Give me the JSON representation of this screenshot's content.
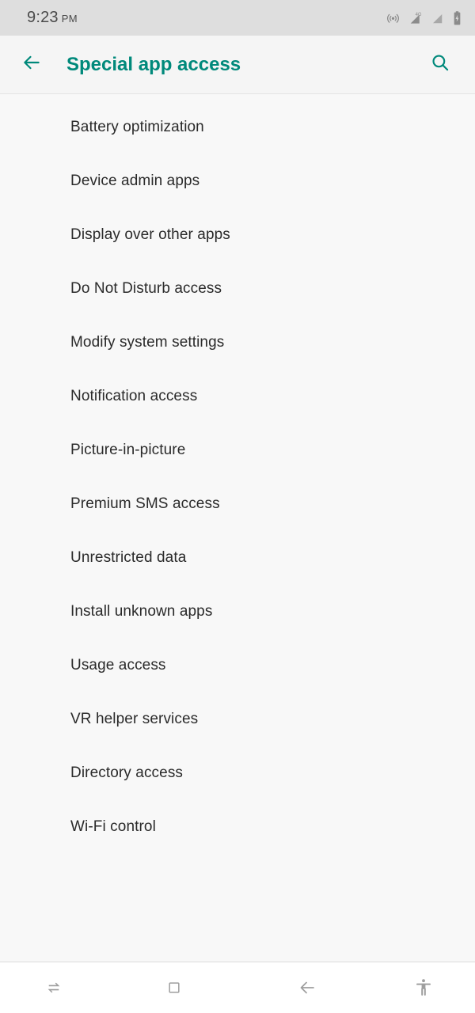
{
  "status_bar": {
    "time": "9:23",
    "ampm": "PM",
    "icons": [
      {
        "name": "hotspot-icon",
        "label": "Hotspot"
      },
      {
        "name": "signal-4g-icon",
        "label": "4G",
        "network": "4G"
      },
      {
        "name": "signal-icon",
        "label": "Signal"
      },
      {
        "name": "battery-charging-icon",
        "label": "Battery charging"
      }
    ]
  },
  "app_bar": {
    "back_label": "Navigate up",
    "title": "Special app access",
    "search_label": "Search"
  },
  "list": {
    "items": [
      {
        "label": "Battery optimization"
      },
      {
        "label": "Device admin apps"
      },
      {
        "label": "Display over other apps"
      },
      {
        "label": "Do Not Disturb access"
      },
      {
        "label": "Modify system settings"
      },
      {
        "label": "Notification access"
      },
      {
        "label": "Picture-in-picture"
      },
      {
        "label": "Premium SMS access"
      },
      {
        "label": "Unrestricted data"
      },
      {
        "label": "Install unknown apps"
      },
      {
        "label": "Usage access"
      },
      {
        "label": "VR helper services"
      },
      {
        "label": "Directory access"
      },
      {
        "label": "Wi-Fi control"
      }
    ]
  },
  "nav_bar": {
    "buttons": [
      {
        "name": "switch-apps-icon",
        "label": "Switch apps"
      },
      {
        "name": "home-square-icon",
        "label": "Home"
      },
      {
        "name": "back-arrow-icon",
        "label": "Back"
      },
      {
        "name": "accessibility-icon",
        "label": "Accessibility"
      }
    ]
  },
  "colors": {
    "accent": "#00897b",
    "status_bar_bg": "#dedede",
    "app_bar_bg": "#f5f5f5",
    "content_bg": "#f8f8f8",
    "nav_bar_bg": "#ffffff",
    "primary_text": "#2a2a2a",
    "status_text": "#4a4a4a",
    "nav_icon": "#9e9e9e"
  }
}
